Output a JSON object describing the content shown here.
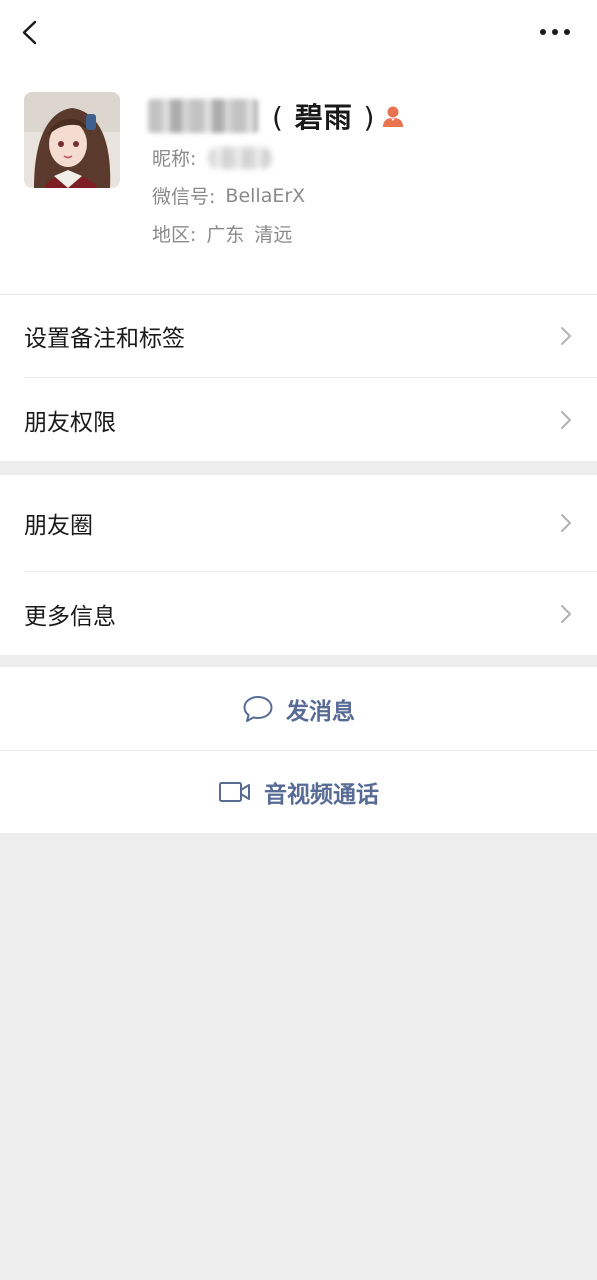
{
  "nav": {
    "back_icon": "back-arrow-icon",
    "more_icon": "more-dots-icon"
  },
  "profile": {
    "remark_open": "(",
    "remark": "碧雨",
    "remark_close": ")",
    "nickname_label": "昵称:",
    "wechat_id_label": "微信号:",
    "wechat_id": "BellaErX",
    "region_label": "地区:",
    "region_province": "广东",
    "region_city": "清远",
    "badge_icon": "person-icon",
    "badge_color": "#e8734f"
  },
  "menu_group_1": [
    {
      "label": "设置备注和标签"
    },
    {
      "label": "朋友权限"
    }
  ],
  "menu_group_2": [
    {
      "label": "朋友圈"
    },
    {
      "label": "更多信息"
    }
  ],
  "actions": {
    "message_label": "发消息",
    "message_icon": "chat-bubble-icon",
    "call_label": "音视频通话",
    "call_icon": "video-camera-icon",
    "accent_color": "#576b95"
  }
}
